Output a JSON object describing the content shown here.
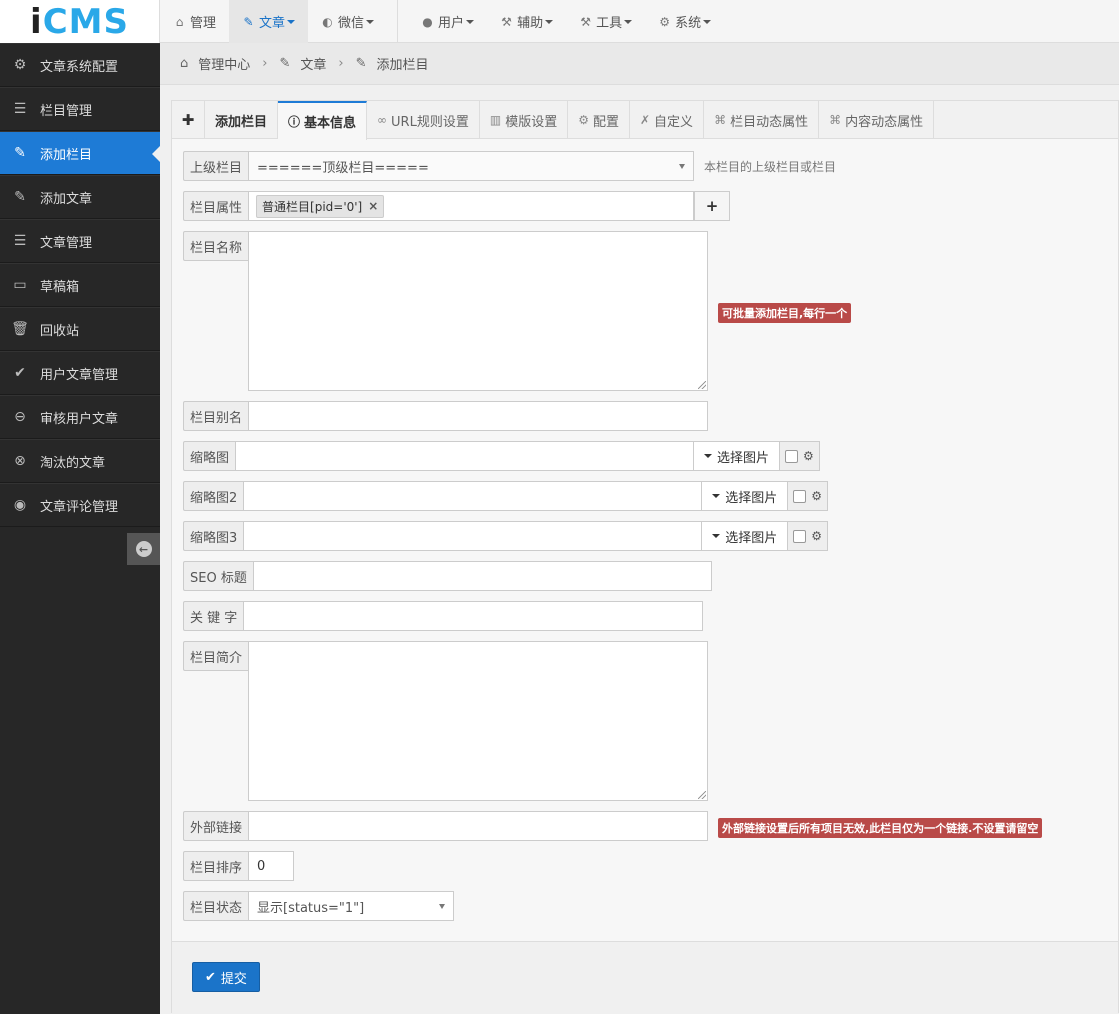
{
  "logo": {
    "part1": "i",
    "part2": "CMS"
  },
  "topnav": {
    "items": [
      {
        "label": "管理",
        "icon": "home-icon"
      },
      {
        "label": "文章",
        "icon": "edit-icon"
      },
      {
        "label": "微信",
        "icon": "wechat-icon"
      },
      {
        "label": "用户",
        "icon": "user-icon"
      },
      {
        "label": "辅助",
        "icon": "gavel-icon"
      },
      {
        "label": "工具",
        "icon": "gavel-icon"
      },
      {
        "label": "系统",
        "icon": "gear-icon"
      }
    ],
    "active": "文章"
  },
  "sidebar": {
    "items": [
      {
        "label": "文章系统配置",
        "icon": "gear-icon"
      },
      {
        "label": "栏目管理",
        "icon": "list-icon"
      },
      {
        "label": "添加栏目",
        "icon": "edit-icon"
      },
      {
        "label": "添加文章",
        "icon": "edit-icon"
      },
      {
        "label": "文章管理",
        "icon": "list-icon"
      },
      {
        "label": "草稿箱",
        "icon": "inbox-icon"
      },
      {
        "label": "回收站",
        "icon": "trash-icon"
      },
      {
        "label": "用户文章管理",
        "icon": "check-circle-icon"
      },
      {
        "label": "审核用户文章",
        "icon": "minus-circle-icon"
      },
      {
        "label": "淘汰的文章",
        "icon": "times-circle-icon"
      },
      {
        "label": "文章评论管理",
        "icon": "comments-icon"
      }
    ],
    "active": "添加栏目"
  },
  "breadcrumb": {
    "home": "管理中心",
    "section": "文章",
    "page": "添加栏目"
  },
  "tabs": {
    "title": "添加栏目",
    "items": [
      {
        "label": "基本信息",
        "icon": "info-icon"
      },
      {
        "label": "URL规则设置",
        "icon": "link-icon"
      },
      {
        "label": "模版设置",
        "icon": "columns-icon"
      },
      {
        "label": "配置",
        "icon": "gear-icon"
      },
      {
        "label": "自定义",
        "icon": "wrench-icon"
      },
      {
        "label": "栏目动态属性",
        "icon": "sitemap-icon"
      },
      {
        "label": "内容动态属性",
        "icon": "sitemap-icon"
      }
    ],
    "active": "基本信息"
  },
  "form": {
    "parent": {
      "label": "上级栏目",
      "value": "======顶级栏目=====",
      "hint": "本栏目的上级栏目或栏目"
    },
    "attr": {
      "label": "栏目属性",
      "tag": "普通栏目[pid='0']",
      "add": "+"
    },
    "name": {
      "label": "栏目名称",
      "hint": "可批量添加栏目,每行一个"
    },
    "alias": {
      "label": "栏目别名",
      "value": ""
    },
    "pic1": {
      "label": "缩略图",
      "button": "选择图片"
    },
    "pic2": {
      "label": "缩略图2",
      "button": "选择图片"
    },
    "pic3": {
      "label": "缩略图3",
      "button": "选择图片"
    },
    "seo": {
      "label": "SEO 标题",
      "value": ""
    },
    "keywords": {
      "label": "关 键 字",
      "value": ""
    },
    "desc": {
      "label": "栏目简介"
    },
    "url": {
      "label": "外部链接",
      "value": "",
      "hint": "外部链接设置后所有项目无效,此栏目仅为一个链接.不设置请留空"
    },
    "order": {
      "label": "栏目排序",
      "value": "0"
    },
    "status": {
      "label": "栏目状态",
      "value": "显示[status=\"1\"]"
    }
  },
  "submit": {
    "label": "提交"
  },
  "colors": {
    "accent": "#1e7bd6",
    "danger": "#b94a48",
    "sidebar": "#272727",
    "logo_blue": "#2aa8e8"
  }
}
